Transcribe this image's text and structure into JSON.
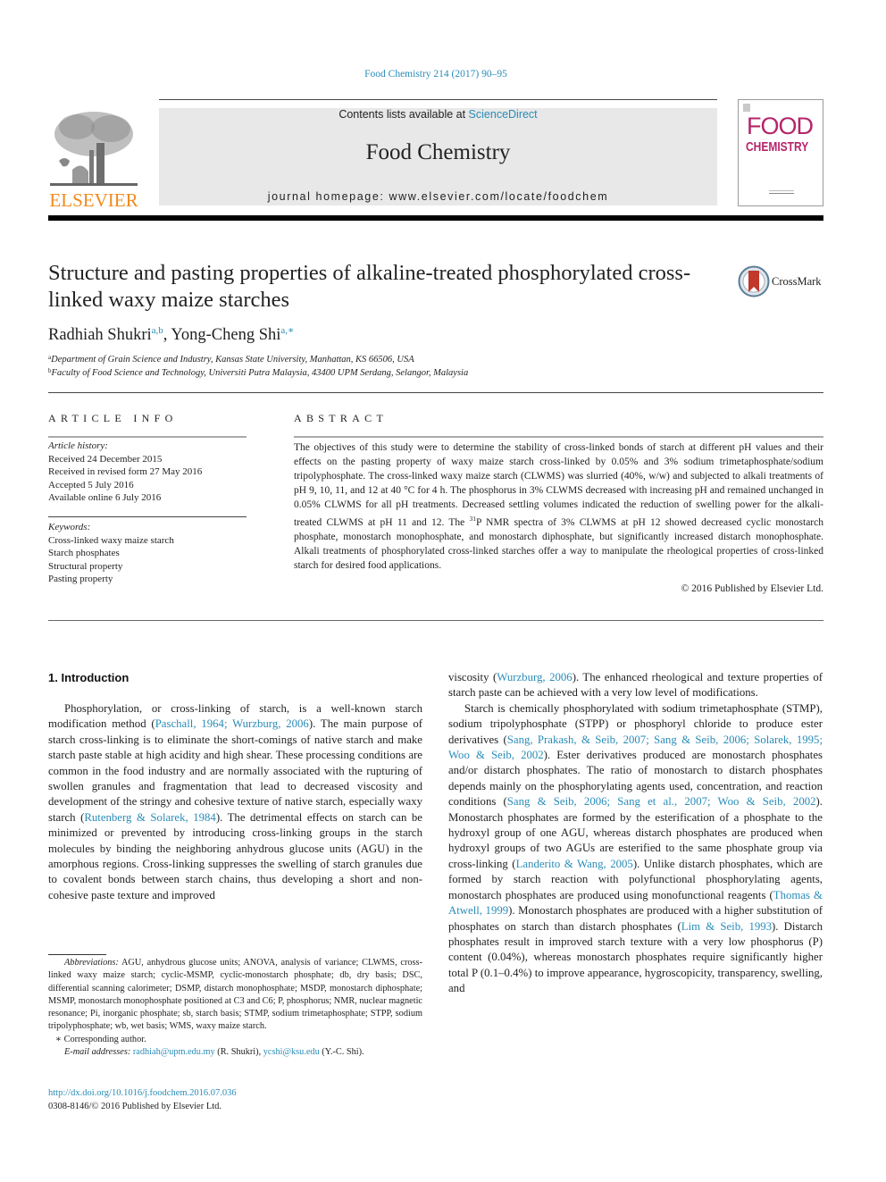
{
  "header": {
    "citation": "Food Chemistry 214 (2017) 90–95",
    "contents_prefix": "Contents lists available at ",
    "contents_link": "ScienceDirect",
    "journal_name": "Food Chemistry",
    "homepage": "journal homepage: www.elsevier.com/locate/foodchem",
    "publisher_logo_text": "ELSEVIER",
    "cover_title_line1": "FOOD",
    "cover_title_line2": "CHEMISTRY",
    "crossmark_label": "CrossMark"
  },
  "article": {
    "title": "Structure and pasting properties of alkaline-treated phosphorylated cross-linked waxy maize starches",
    "authors": [
      {
        "name": "Radhiah Shukri",
        "sup": "a,b"
      },
      {
        "name": "Yong-Cheng Shi",
        "sup": "a,∗"
      }
    ],
    "author_separator": ", ",
    "affiliations": [
      {
        "mark": "a",
        "text": "Department of Grain Science and Industry, Kansas State University, Manhattan, KS 66506, USA"
      },
      {
        "mark": "b",
        "text": "Faculty of Food Science and Technology, Universiti Putra Malaysia, 43400 UPM Serdang, Selangor, Malaysia"
      }
    ]
  },
  "article_info": {
    "label": "ARTICLE INFO",
    "history_head": "Article history:",
    "history": [
      "Received 24 December 2015",
      "Received in revised form 27 May 2016",
      "Accepted 5 July 2016",
      "Available online 6 July 2016"
    ],
    "keywords_head": "Keywords:",
    "keywords": [
      "Cross-linked waxy maize starch",
      "Starch phosphates",
      "Structural property",
      "Pasting property"
    ]
  },
  "abstract": {
    "label": "ABSTRACT",
    "text_part1": "The objectives of this study were to determine the stability of cross-linked bonds of starch at different pH values and their effects on the pasting property of waxy maize starch cross-linked by 0.05% and 3% sodium trimetaphosphate/sodium tripolyphosphate. The cross-linked waxy maize starch (CLWMS) was slurried (40%, w/w) and subjected to alkali treatments of pH 9, 10, 11, and 12 at 40 °C for 4 h. The phosphorus in 3% CLWMS decreased with increasing pH and remained unchanged in 0.05% CLWMS for all pH treatments. Decreased settling volumes indicated the reduction of swelling power for the alkali-treated CLWMS at pH 11 and 12. The ",
    "sup": "31",
    "text_part2": "P NMR spectra of 3% CLWMS at pH 12 showed decreased cyclic monostarch phosphate, monostarch monophosphate, and monostarch diphosphate, but significantly increased distarch monophosphate. Alkali treatments of phosphorylated cross-linked starches offer a way to manipulate the rheological properties of cross-linked starch for desired food applications.",
    "copyright": "© 2016 Published by Elsevier Ltd."
  },
  "introduction": {
    "heading": "1. Introduction",
    "left_column": [
      {
        "t": "Phosphorylation, or cross-linking of starch, is a well-known starch modification method ("
      },
      {
        "link": "Paschall, 1964; Wurzburg, 2006"
      },
      {
        "t": "). The main purpose of starch cross-linking is to eliminate the short-comings of native starch and make starch paste stable at high acidity and high shear. These processing conditions are common in the food industry and are normally associated with the rupturing of swollen granules and fragmentation that lead to decreased viscosity and development of the stringy and cohesive texture of native starch, especially waxy starch ("
      },
      {
        "link": "Rutenberg & Solarek, 1984"
      },
      {
        "t": "). The detrimental effects on starch can be minimized or prevented by introducing cross-linking groups in the starch molecules by binding the neighboring anhydrous glucose units (AGU) in the amorphous regions. Cross-linking suppresses the swelling of starch granules due to covalent bonds between starch chains, thus developing a short and non-cohesive paste texture and improved"
      }
    ],
    "right_column_p1": [
      {
        "t": "viscosity ("
      },
      {
        "link": "Wurzburg, 2006"
      },
      {
        "t": "). The enhanced rheological and texture properties of starch paste can be achieved with a very low level of modifications."
      }
    ],
    "right_column_p2": [
      {
        "t": "Starch is chemically phosphorylated with sodium trimetaphosphate (STMP), sodium tripolyphosphate (STPP) or phosphoryl chloride to produce ester derivatives ("
      },
      {
        "link": "Sang, Prakash, & Seib, 2007; Sang & Seib, 2006; Solarek, 1995; Woo & Seib, 2002"
      },
      {
        "t": "). Ester derivatives produced are monostarch phosphates and/or distarch phosphates. The ratio of monostarch to distarch phosphates depends mainly on the phosphorylating agents used, concentration, and reaction conditions ("
      },
      {
        "link": "Sang & Seib, 2006; Sang et al., 2007; Woo & Seib, 2002"
      },
      {
        "t": "). Monostarch phosphates are formed by the esterification of a phosphate to the hydroxyl group of one AGU, whereas distarch phosphates are produced when hydroxyl groups of two AGUs are esterified to the same phosphate group via cross-linking ("
      },
      {
        "link": "Landerito & Wang, 2005"
      },
      {
        "t": "). Unlike distarch phosphates, which are formed by starch reaction with polyfunctional phosphorylating agents, monostarch phosphates are produced using monofunctional reagents ("
      },
      {
        "link": "Thomas & Atwell, 1999"
      },
      {
        "t": "). Monostarch phosphates are produced with a higher substitution of phosphates on starch than distarch phosphates ("
      },
      {
        "link": "Lim & Seib, 1993"
      },
      {
        "t": "). Distarch phosphates result in improved starch texture with a very low phosphorus (P) content (0.04%), whereas monostarch phosphates require significantly higher total P (0.1–0.4%) to improve appearance, hygroscopicity, transparency, swelling, and"
      }
    ]
  },
  "footnotes": {
    "abbreviations_head": "Abbreviations:",
    "abbreviations": " AGU, anhydrous glucose units; ANOVA, analysis of variance; CLWMS, cross-linked waxy maize starch; cyclic-MSMP, cyclic-monostarch phosphate; db, dry basis; DSC, differential scanning calorimeter; DSMP, distarch monophosphate; MSDP, monostarch diphosphate; MSMP, monostarch monophosphate positioned at C3 and C6; P, phosphorus; NMR, nuclear magnetic resonance; Pi, inorganic phosphate; sb, starch basis; STMP, sodium trimetaphosphate; STPP, sodium tripolyphosphate; wb, wet basis; WMS, waxy maize starch.",
    "corresponding": "∗ Corresponding author.",
    "email_head": "E-mail addresses:",
    "email1": "radhiah@upm.edu.my",
    "email1_name": " (R. Shukri), ",
    "email2": "ycshi@ksu.edu",
    "email2_name": " (Y.-C. Shi)."
  },
  "doi": {
    "url": "http://dx.doi.org/10.1016/j.foodchem.2016.07.036",
    "issn_line": "0308-8146/© 2016 Published by Elsevier Ltd."
  },
  "colors": {
    "link": "#2a8cb8",
    "elsevier_orange": "#f08a1c",
    "cover_magenta": "#b5246a",
    "masthead_gray": "#e8e8e8"
  }
}
